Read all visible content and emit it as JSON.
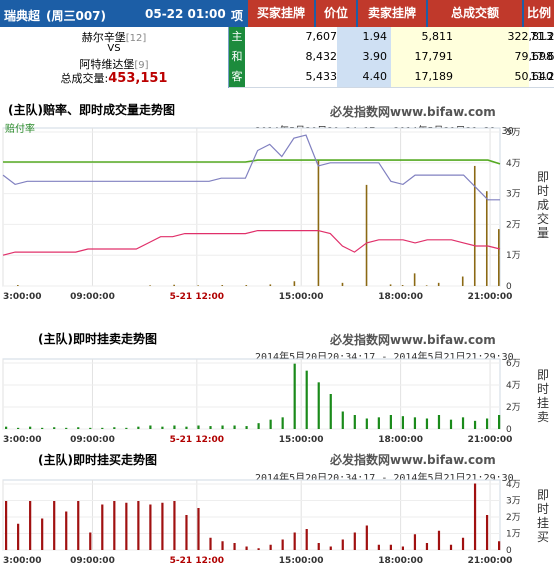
{
  "header": {
    "league": "瑞典超",
    "weekday": "(周三007)",
    "datetime": "05-22 01:00",
    "col_item": "项",
    "col_buy": "买家挂牌",
    "col_price": "价位",
    "col_sell": "卖家挂牌",
    "col_volume": "总成交额",
    "col_ratio": "比例"
  },
  "match": {
    "home": "赫尔辛堡",
    "home_rank": "[12]",
    "vs": "VS",
    "away": "阿特维达堡",
    "away_rank": "[9]",
    "volume_label": "总成交量:",
    "volume_value": "453,151"
  },
  "rows": [
    {
      "label": "主",
      "buy": "7,607",
      "price": "1.94",
      "sell": "5,811",
      "volume": "322,813",
      "ratio": "71.2"
    },
    {
      "label": "和",
      "buy": "8,432",
      "price": "3.90",
      "sell": "17,791",
      "volume": "79,698",
      "ratio": "17.6"
    },
    {
      "label": "客",
      "buy": "5,433",
      "price": "4.40",
      "sell": "17,189",
      "volume": "50,640",
      "ratio": "11.2"
    }
  ],
  "colors": {
    "header_blue": "#1c5ea6",
    "header_red": "#c0392b",
    "label_green": "#1c8b3c",
    "odds_green": "#55aa22",
    "odds_purple": "#8080c0",
    "odds_pink": "#e0306a",
    "volume_bar": "#8b6914",
    "sell_bar": "#1a8a1a",
    "buy_bar": "#a01010"
  },
  "panels": {
    "p1": {
      "title": "(主队)赔率、即时成交量走势图",
      "watermark": "必发指数网www.bifaw.com",
      "range": "2014年5月20日20:34:17 - 2014年5月21日21:29:30",
      "legend": "赔付率",
      "side_label": "即时成交量"
    },
    "p2": {
      "title": "(主队)即时挂卖走势图",
      "watermark": "必发指数网www.bifaw.com",
      "range": "2014年5月20日20:34:17 - 2014年5月21日21:29:30",
      "side_label": "即时挂卖"
    },
    "p3": {
      "title": "(主队)即时挂买走势图",
      "watermark": "必发指数网www.bifaw.com",
      "range": "2014年5月20日20:34:17 - 2014年5月21日21:29:30",
      "side_label": "即时挂买"
    }
  },
  "chart_data": [
    {
      "type": "line",
      "title": "(主队)赔率、即时成交量走势图",
      "x_ticks": [
        "3:00:00",
        "09:00:00",
        "5-21 12:00",
        "15:00:00",
        "18:00:00",
        "21:00:00"
      ],
      "y_ticks_right": [
        "5万",
        "4万",
        "3万",
        "2万",
        "1万",
        "0"
      ],
      "ylim": [
        0,
        50000
      ],
      "series": [
        {
          "name": "赔付率",
          "values": [
            0.66,
            0.66,
            0.66,
            0.66,
            0.66,
            0.66,
            0.66,
            0.66,
            0.66,
            0.66,
            0.66,
            0.66,
            0.66,
            0.66,
            0.66,
            0.66,
            0.66,
            0.66,
            0.66,
            0.66,
            0.66,
            0.67,
            0.67,
            0.67,
            0.67,
            0.67,
            0.67,
            0.67,
            0.67,
            0.67,
            0.67,
            0.67,
            0.67,
            0.67,
            0.67,
            0.67,
            0.67,
            0.67,
            0.67,
            0.67,
            0.67,
            0.65
          ]
        },
        {
          "values": [
            3.6,
            3.3,
            3.4,
            3.4,
            3.4,
            3.4,
            3.4,
            3.4,
            3.4,
            3.4,
            3.4,
            3.4,
            3.4,
            3.4,
            3.4,
            3.4,
            3.4,
            3.4,
            3.5,
            3.5,
            3.5,
            4.4,
            4.6,
            4.2,
            4.8,
            4.9,
            3.9,
            4.0,
            4.0,
            4.0,
            4.0,
            4.0,
            3.4,
            3.3,
            3.6,
            3.6,
            3.6,
            3.6,
            3.6,
            3.2,
            2.8,
            2.8
          ]
        },
        {
          "values": [
            1.0,
            1.1,
            1.1,
            1.1,
            1.1,
            1.1,
            1.1,
            1.2,
            1.2,
            1.2,
            1.2,
            1.2,
            1.4,
            1.6,
            1.6,
            1.7,
            1.7,
            1.7,
            1.7,
            1.7,
            1.7,
            1.8,
            1.8,
            1.8,
            1.8,
            1.8,
            1.8,
            1.7,
            1.3,
            1.1,
            1.4,
            1.5,
            1.5,
            1.5,
            1.4,
            1.5,
            1.5,
            1.5,
            1.4,
            1.3,
            1.3,
            1.2
          ]
        }
      ],
      "volume_bars": [
        0,
        300,
        0,
        0,
        0,
        0,
        0,
        0,
        0,
        0,
        0,
        0,
        200,
        0,
        400,
        0,
        200,
        0,
        300,
        0,
        300,
        0,
        500,
        0,
        1500,
        0,
        40000,
        0,
        1000,
        0,
        32000,
        0,
        500,
        300,
        4000,
        200,
        1000,
        0,
        3000,
        38000,
        30000,
        18000
      ]
    },
    {
      "type": "bar",
      "title": "(主队)即时挂卖走势图",
      "x_ticks": [
        "3:00:00",
        "09:00:00",
        "5-21 12:00",
        "15:00:00",
        "18:00:00",
        "21:00:00"
      ],
      "y_ticks_right": [
        "6万",
        "4万",
        "2万",
        "0"
      ],
      "ylim": [
        0,
        60000
      ],
      "values": [
        2000,
        1000,
        2000,
        1000,
        1500,
        1000,
        1500,
        1000,
        1000,
        1500,
        1000,
        2000,
        3000,
        2000,
        3000,
        2000,
        3000,
        2500,
        3000,
        3000,
        2500,
        5000,
        8000,
        10000,
        56000,
        50000,
        40000,
        30000,
        15000,
        12000,
        9000,
        10000,
        12000,
        11000,
        10000,
        9000,
        12000,
        8000,
        10000,
        7000,
        9000,
        12000
      ]
    },
    {
      "type": "bar",
      "title": "(主队)即时挂买走势图",
      "x_ticks": [
        "3:00:00",
        "09:00:00",
        "5-21 12:00",
        "15:00:00",
        "18:00:00",
        "21:00:00"
      ],
      "y_ticks_right": [
        "4万",
        "3万",
        "2万",
        "1万",
        "0"
      ],
      "ylim": [
        0,
        40000
      ],
      "values": [
        28000,
        15000,
        28000,
        18000,
        28000,
        22000,
        28000,
        10000,
        26000,
        28000,
        27000,
        28000,
        26000,
        27000,
        28000,
        20000,
        24000,
        7000,
        5000,
        4000,
        2000,
        1000,
        3000,
        6000,
        10000,
        12000,
        4000,
        2000,
        6000,
        10000,
        14000,
        3000,
        3000,
        2000,
        9000,
        4000,
        11000,
        3000,
        7000,
        38000,
        20000,
        5000
      ]
    }
  ]
}
